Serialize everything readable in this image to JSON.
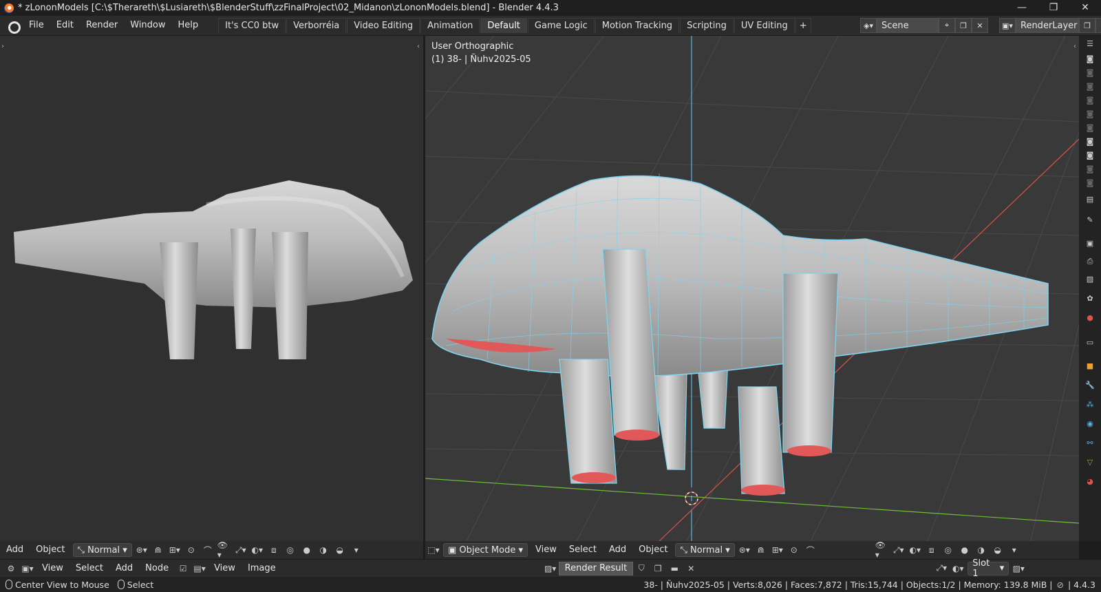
{
  "window": {
    "title": "* zLononModels [C:\\$Therareth\\$Lusiareth\\$BlenderStuff\\zzFinalProject\\02_Midanon\\zLononModels.blend] - Blender 4.4.3",
    "minimize": "—",
    "maximize": "❐",
    "close": "✕"
  },
  "menu": {
    "items": [
      "File",
      "Edit",
      "Render",
      "Window",
      "Help"
    ]
  },
  "workspaces": {
    "tabs": [
      "It's CC0 btw",
      "Verborréia",
      "Video Editing",
      "Animation",
      "Default",
      "Game Logic",
      "Motion Tracking",
      "Scripting",
      "UV Editing"
    ],
    "active": "Default",
    "add": "+"
  },
  "scene": {
    "name": "Scene",
    "render_layer": "RenderLayer"
  },
  "left_editor": {
    "header": {
      "add": "Add",
      "object": "Object",
      "orientation": "Normal"
    }
  },
  "viewport": {
    "view_label": "User Orthographic",
    "object_label": "(1) 38- | Ñuhv2025-05",
    "header": {
      "mode": "Object Mode",
      "view": "View",
      "select": "Select",
      "add": "Add",
      "object": "Object",
      "orientation": "Normal"
    }
  },
  "image_editor": {
    "view": "View",
    "select": "Select",
    "add": "Add",
    "node": "Node",
    "view2": "View",
    "image": "Image",
    "image_name": "Render Result",
    "slot": "Slot 1"
  },
  "status": {
    "center_view": "Center View to Mouse",
    "select": "Select",
    "stats": "38- | Ñuhv2025-05 | Verts:8,026 | Faces:7,872 | Tris:15,744 | Objects:1/2 | Memory: 139.8 MiB |",
    "version": "4.4.3"
  },
  "colors": {
    "wire": "#7fd4f0",
    "x_axis": "#d9534f",
    "y_axis": "#6fbf3a",
    "z_axis": "#5ab4e0",
    "cap": "#e05858"
  }
}
